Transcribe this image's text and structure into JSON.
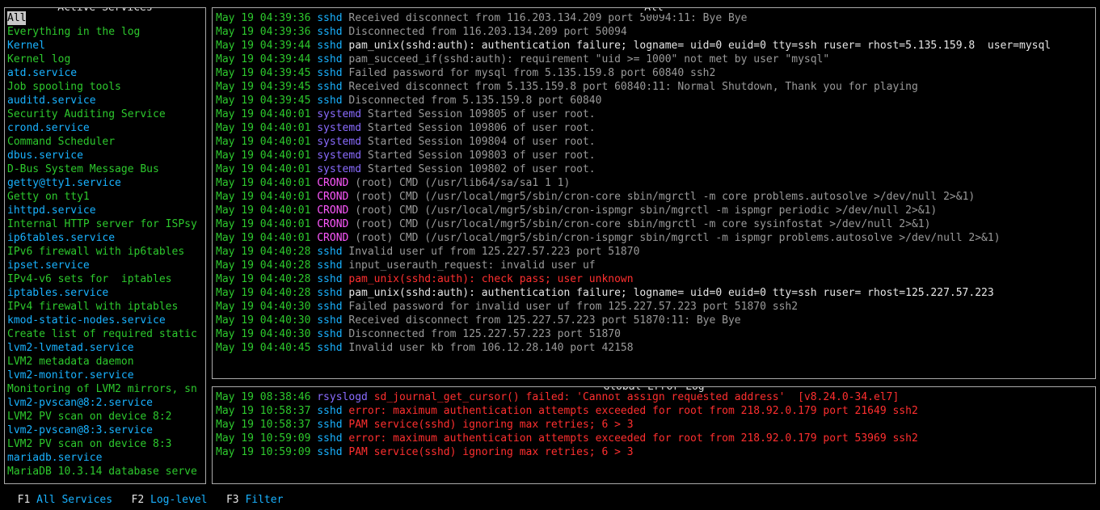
{
  "panels": {
    "services_title": "Active Services",
    "all_title": "All",
    "error_title": "Global Error Log"
  },
  "services": [
    {
      "name": "All",
      "desc": "Everything in the log",
      "selected": true
    },
    {
      "name": "Kernel",
      "desc": "Kernel log"
    },
    {
      "name": "atd.service",
      "desc": "Job spooling tools"
    },
    {
      "name": "auditd.service",
      "desc": "Security Auditing Service"
    },
    {
      "name": "crond.service",
      "desc": "Command Scheduler"
    },
    {
      "name": "dbus.service",
      "desc": "D-Bus System Message Bus"
    },
    {
      "name": "getty@tty1.service",
      "desc": "Getty on tty1"
    },
    {
      "name": "ihttpd.service",
      "desc": "Internal HTTP server for ISPsy"
    },
    {
      "name": "ip6tables.service",
      "desc": "IPv6 firewall with ip6tables"
    },
    {
      "name": "ipset.service",
      "desc": "IPv4-v6 sets for  iptables"
    },
    {
      "name": "iptables.service",
      "desc": "IPv4 firewall with iptables"
    },
    {
      "name": "kmod-static-nodes.service",
      "desc": "Create list of required static"
    },
    {
      "name": "lvm2-lvmetad.service",
      "desc": "LVM2 metadata daemon"
    },
    {
      "name": "lvm2-monitor.service",
      "desc": "Monitoring of LVM2 mirrors, sn"
    },
    {
      "name": "lvm2-pvscan@8:2.service",
      "desc": "LVM2 PV scan on device 8:2"
    },
    {
      "name": "lvm2-pvscan@8:3.service",
      "desc": "LVM2 PV scan on device 8:3"
    },
    {
      "name": "mariadb.service",
      "desc": "MariaDB 10.3.14 database serve"
    }
  ],
  "log": [
    {
      "ts": "May 19 04:39:36",
      "unit": "sshd",
      "ucls": "sshd",
      "msg": "Received disconnect from 116.203.134.209 port 50094:11: Bye Bye",
      "mcls": "msg"
    },
    {
      "ts": "May 19 04:39:36",
      "unit": "sshd",
      "ucls": "sshd",
      "msg": "Disconnected from 116.203.134.209 port 50094",
      "mcls": "msg"
    },
    {
      "ts": "May 19 04:39:44",
      "unit": "sshd",
      "ucls": "sshd",
      "msg": "pam_unix(sshd:auth): authentication failure; logname= uid=0 euid=0 tty=ssh ruser= rhost=5.135.159.8  user=mysql",
      "mcls": "msg-white"
    },
    {
      "ts": "May 19 04:39:44",
      "unit": "sshd",
      "ucls": "sshd",
      "msg": "pam_succeed_if(sshd:auth): requirement \"uid >= 1000\" not met by user \"mysql\"",
      "mcls": "msg"
    },
    {
      "ts": "May 19 04:39:45",
      "unit": "sshd",
      "ucls": "sshd",
      "msg": "Failed password for mysql from 5.135.159.8 port 60840 ssh2",
      "mcls": "msg"
    },
    {
      "ts": "May 19 04:39:45",
      "unit": "sshd",
      "ucls": "sshd",
      "msg": "Received disconnect from 5.135.159.8 port 60840:11: Normal Shutdown, Thank you for playing",
      "mcls": "msg"
    },
    {
      "ts": "May 19 04:39:45",
      "unit": "sshd",
      "ucls": "sshd",
      "msg": "Disconnected from 5.135.159.8 port 60840",
      "mcls": "msg"
    },
    {
      "ts": "May 19 04:40:01",
      "unit": "systemd",
      "ucls": "sys",
      "msg": "Started Session 109805 of user root.",
      "mcls": "msg"
    },
    {
      "ts": "May 19 04:40:01",
      "unit": "systemd",
      "ucls": "sys",
      "msg": "Started Session 109806 of user root.",
      "mcls": "msg"
    },
    {
      "ts": "May 19 04:40:01",
      "unit": "systemd",
      "ucls": "sys",
      "msg": "Started Session 109804 of user root.",
      "mcls": "msg"
    },
    {
      "ts": "May 19 04:40:01",
      "unit": "systemd",
      "ucls": "sys",
      "msg": "Started Session 109803 of user root.",
      "mcls": "msg"
    },
    {
      "ts": "May 19 04:40:01",
      "unit": "systemd",
      "ucls": "sys",
      "msg": "Started Session 109802 of user root.",
      "mcls": "msg"
    },
    {
      "ts": "May 19 04:40:01",
      "unit": "CROND",
      "ucls": "crond",
      "msg": "(root) CMD (/usr/lib64/sa/sa1 1 1)",
      "mcls": "msg"
    },
    {
      "ts": "May 19 04:40:01",
      "unit": "CROND",
      "ucls": "crond",
      "msg": "(root) CMD (/usr/local/mgr5/sbin/cron-core sbin/mgrctl -m core problems.autosolve >/dev/null 2>&1)",
      "mcls": "msg"
    },
    {
      "ts": "May 19 04:40:01",
      "unit": "CROND",
      "ucls": "crond",
      "msg": "(root) CMD (/usr/local/mgr5/sbin/cron-ispmgr sbin/mgrctl -m ispmgr periodic >/dev/null 2>&1)",
      "mcls": "msg"
    },
    {
      "ts": "May 19 04:40:01",
      "unit": "CROND",
      "ucls": "crond",
      "msg": "(root) CMD (/usr/local/mgr5/sbin/cron-core sbin/mgrctl -m core sysinfostat >/dev/null 2>&1)",
      "mcls": "msg"
    },
    {
      "ts": "May 19 04:40:01",
      "unit": "CROND",
      "ucls": "crond",
      "msg": "(root) CMD (/usr/local/mgr5/sbin/cron-ispmgr sbin/mgrctl -m ispmgr problems.autosolve >/dev/null 2>&1)",
      "mcls": "msg"
    },
    {
      "ts": "May 19 04:40:28",
      "unit": "sshd",
      "ucls": "sshd",
      "msg": "Invalid user uf from 125.227.57.223 port 51870",
      "mcls": "msg"
    },
    {
      "ts": "May 19 04:40:28",
      "unit": "sshd",
      "ucls": "sshd",
      "msg": "input_userauth_request: invalid user uf",
      "mcls": "msg"
    },
    {
      "ts": "May 19 04:40:28",
      "unit": "sshd",
      "ucls": "sshd",
      "msg": "pam_unix(sshd:auth): check pass; user unknown",
      "mcls": "msg-warn"
    },
    {
      "ts": "May 19 04:40:28",
      "unit": "sshd",
      "ucls": "sshd",
      "msg": "pam_unix(sshd:auth): authentication failure; logname= uid=0 euid=0 tty=ssh ruser= rhost=125.227.57.223",
      "mcls": "msg-white"
    },
    {
      "ts": "May 19 04:40:30",
      "unit": "sshd",
      "ucls": "sshd",
      "msg": "Failed password for invalid user uf from 125.227.57.223 port 51870 ssh2",
      "mcls": "msg"
    },
    {
      "ts": "May 19 04:40:30",
      "unit": "sshd",
      "ucls": "sshd",
      "msg": "Received disconnect from 125.227.57.223 port 51870:11: Bye Bye",
      "mcls": "msg"
    },
    {
      "ts": "May 19 04:40:30",
      "unit": "sshd",
      "ucls": "sshd",
      "msg": "Disconnected from 125.227.57.223 port 51870",
      "mcls": "msg"
    },
    {
      "ts": "May 19 04:40:45",
      "unit": "sshd",
      "ucls": "sshd",
      "msg": "Invalid user kb from 106.12.28.140 port 42158",
      "mcls": "msg"
    }
  ],
  "errlog": [
    {
      "ts": "May 19 08:38:46",
      "unit": "rsyslogd",
      "ucls": "sys",
      "msg": "sd_journal_get_cursor() failed: 'Cannot assign requested address'  [v8.24.0-34.el7]",
      "mcls": "msg-warn"
    },
    {
      "ts": "May 19 10:58:37",
      "unit": "sshd",
      "ucls": "sshd",
      "msg": "error: maximum authentication attempts exceeded for root from 218.92.0.179 port 21649 ssh2",
      "mcls": "msg-warn"
    },
    {
      "ts": "May 19 10:58:37",
      "unit": "sshd",
      "ucls": "sshd",
      "msg": "PAM service(sshd) ignoring max retries; 6 > 3",
      "mcls": "msg-warn"
    },
    {
      "ts": "May 19 10:59:09",
      "unit": "sshd",
      "ucls": "sshd",
      "msg": "error: maximum authentication attempts exceeded for root from 218.92.0.179 port 53969 ssh2",
      "mcls": "msg-warn"
    },
    {
      "ts": "May 19 10:59:09",
      "unit": "sshd",
      "ucls": "sshd",
      "msg": "PAM service(sshd) ignoring max retries; 6 > 3",
      "mcls": "msg-warn"
    }
  ],
  "footer": {
    "f1_key": "F1",
    "f1_action": "All Services",
    "f2_key": "F2",
    "f2_action": "Log-level",
    "f3_key": "F3",
    "f3_action": "Filter"
  }
}
